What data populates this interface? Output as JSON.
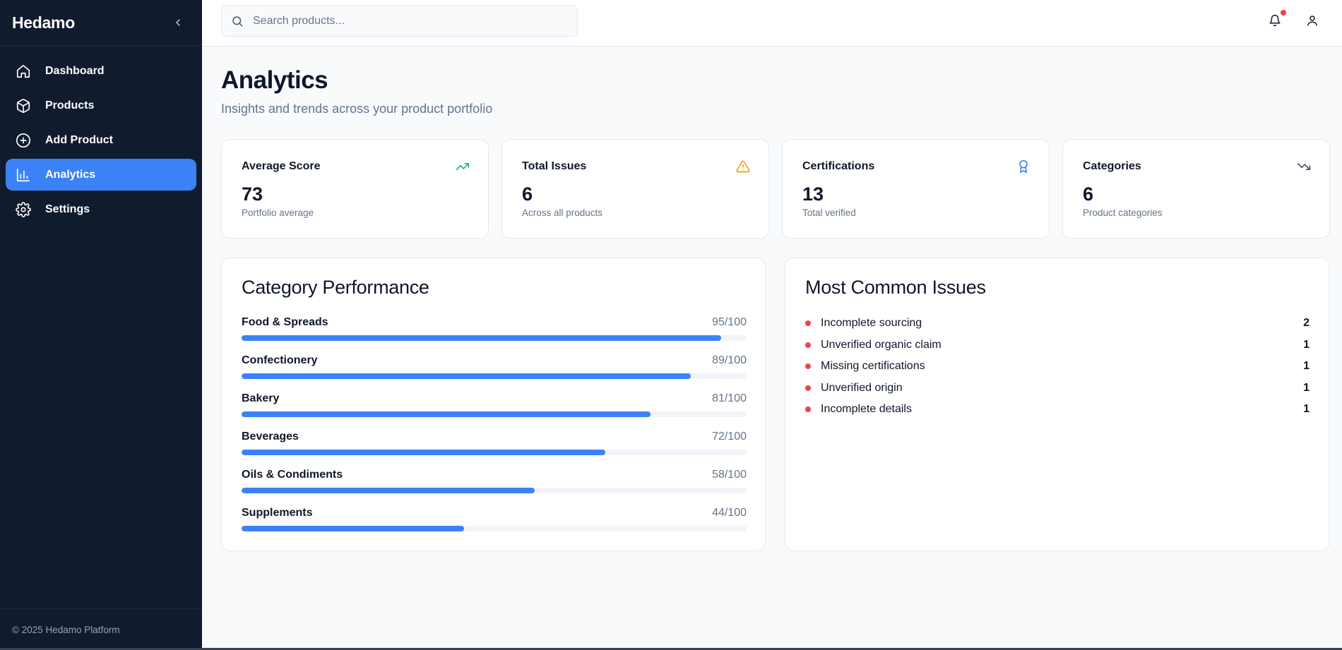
{
  "sidebar": {
    "brand": "Hedamo",
    "items": [
      {
        "label": "Dashboard",
        "icon": "home-icon"
      },
      {
        "label": "Products",
        "icon": "box-icon"
      },
      {
        "label": "Add Product",
        "icon": "plus-circle-icon"
      },
      {
        "label": "Analytics",
        "icon": "bar-chart-icon",
        "active": true
      },
      {
        "label": "Settings",
        "icon": "gear-icon"
      }
    ],
    "footer": "© 2025 Hedamo Platform"
  },
  "topbar": {
    "search_placeholder": "Search products..."
  },
  "page": {
    "title": "Analytics",
    "subtitle": "Insights and trends across your product portfolio"
  },
  "stats": [
    {
      "title": "Average Score",
      "value": "73",
      "desc": "Portfolio average",
      "icon": "trending-up-icon",
      "color": "#10b981"
    },
    {
      "title": "Total Issues",
      "value": "6",
      "desc": "Across all products",
      "icon": "warning-icon",
      "color": "#f59e0b"
    },
    {
      "title": "Certifications",
      "value": "13",
      "desc": "Total verified",
      "icon": "award-icon",
      "color": "#3b82f6"
    },
    {
      "title": "Categories",
      "value": "6",
      "desc": "Product categories",
      "icon": "trending-down-icon",
      "color": "#475569"
    }
  ],
  "category_performance": {
    "title": "Category Performance",
    "items": [
      {
        "name": "Food & Spreads",
        "score": "95/100",
        "value": 95
      },
      {
        "name": "Confectionery",
        "score": "89/100",
        "value": 89
      },
      {
        "name": "Bakery",
        "score": "81/100",
        "value": 81
      },
      {
        "name": "Beverages",
        "score": "72/100",
        "value": 72
      },
      {
        "name": "Oils & Condiments",
        "score": "58/100",
        "value": 58
      },
      {
        "name": "Supplements",
        "score": "44/100",
        "value": 44
      }
    ]
  },
  "common_issues": {
    "title": "Most Common Issues",
    "items": [
      {
        "label": "Incomplete sourcing",
        "count": "2"
      },
      {
        "label": "Unverified organic claim",
        "count": "1"
      },
      {
        "label": "Missing certifications",
        "count": "1"
      },
      {
        "label": "Unverified origin",
        "count": "1"
      },
      {
        "label": "Incomplete details",
        "count": "1"
      }
    ]
  },
  "colors": {
    "sidebar_bg": "#111b2e",
    "accent": "#3b82f6",
    "danger": "#ef4444"
  }
}
